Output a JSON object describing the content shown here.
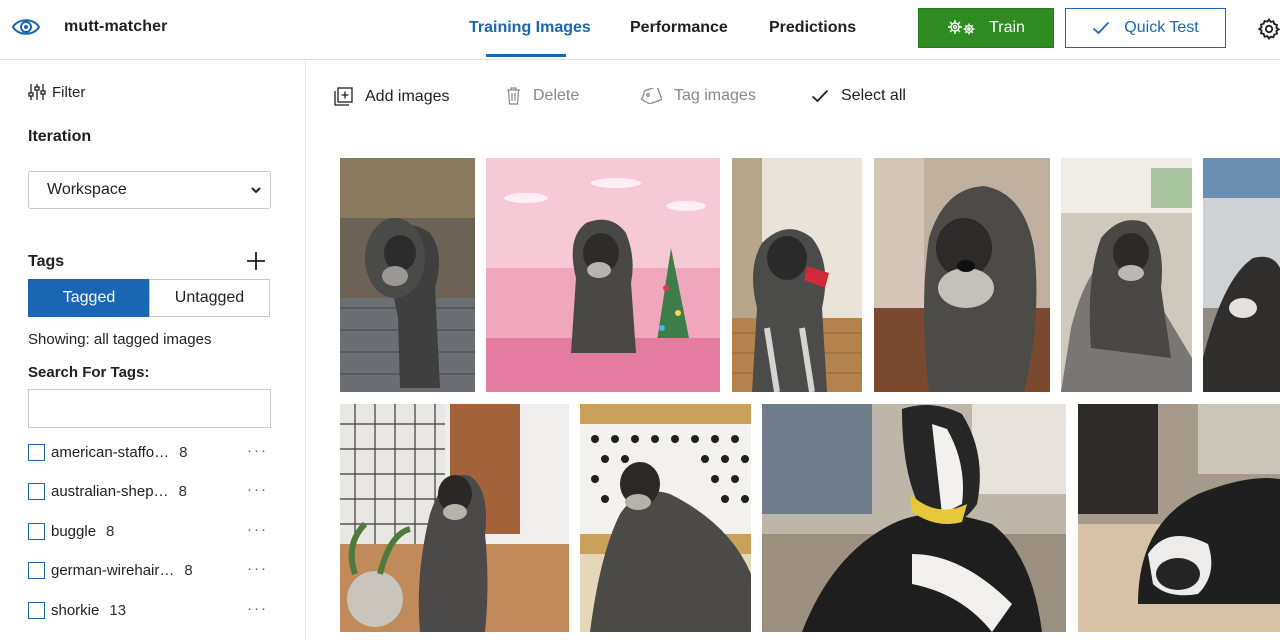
{
  "app": {
    "name": "mutt-matcher",
    "logo_icon": "eye-icon"
  },
  "nav": {
    "tabs": [
      {
        "label": "Training Images",
        "active": true
      },
      {
        "label": "Performance",
        "active": false
      },
      {
        "label": "Predictions",
        "active": false
      }
    ]
  },
  "actions": {
    "train_label": "Train",
    "train_icon": "gears-icon",
    "quick_test_label": "Quick Test",
    "quick_test_icon": "check-icon",
    "settings_icon": "gear-icon",
    "train_color": "#2e8b21",
    "accent_color": "#1a66b5"
  },
  "sidebar": {
    "filter_label": "Filter",
    "iteration_label": "Iteration",
    "iteration_value": "Workspace",
    "tags_label": "Tags",
    "segments": {
      "tagged": "Tagged",
      "untagged": "Untagged"
    },
    "showing_text": "Showing: all tagged images",
    "search_label": "Search For Tags:",
    "search_value": "",
    "tags": [
      {
        "name": "american-staffo…",
        "count": "8"
      },
      {
        "name": "australian-shep…",
        "count": "8"
      },
      {
        "name": "buggle",
        "count": "8"
      },
      {
        "name": "german-wirehair…",
        "count": "8"
      },
      {
        "name": "shorkie",
        "count": "13"
      }
    ],
    "more_label": "···"
  },
  "toolbar": {
    "add_images": "Add images",
    "delete": "Delete",
    "tag_images": "Tag images",
    "select_all": "Select all"
  },
  "images": [
    {
      "subject": "wirehaired dog standing on wooden deck"
    },
    {
      "subject": "wirehaired dog on pink background with christmas tree"
    },
    {
      "subject": "wirehaired dog with red toy in hallway"
    },
    {
      "subject": "close-up of wirehaired dog face"
    },
    {
      "subject": "wirehaired dog lying on couch"
    },
    {
      "subject": "dog partially visible on right edge"
    },
    {
      "subject": "wirehaired dog sitting by white wall"
    },
    {
      "subject": "wirehaired dog lying on patterned pillow"
    },
    {
      "subject": "black and white dog with yellow collar on bed"
    },
    {
      "subject": "black and white dog sleeping on couch"
    }
  ]
}
